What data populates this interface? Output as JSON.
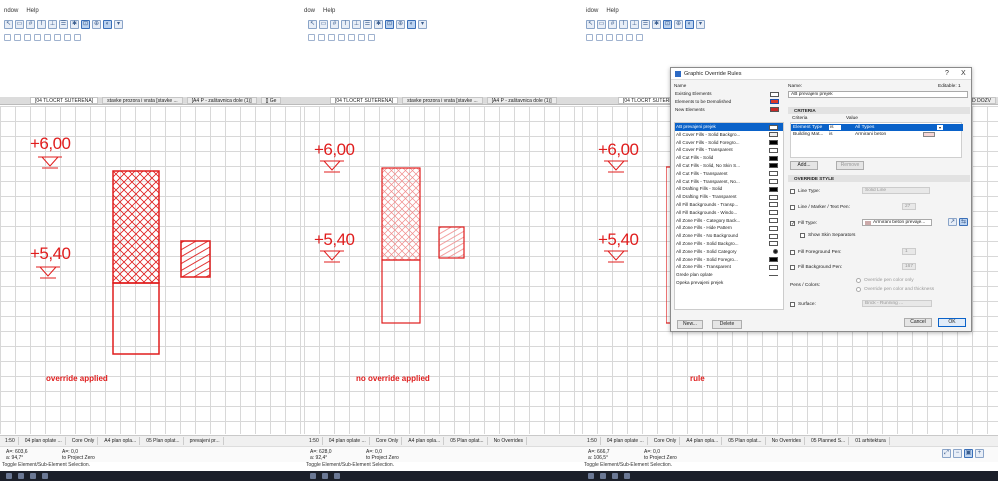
{
  "menu": {
    "window": "ndow",
    "help": "Help",
    "window2": "dow",
    "window3": "idow"
  },
  "tabs": {
    "p1": [
      "[04 TLOCRT SUTERENA]",
      "stavke prozora i vrata [stavke ...",
      "[A4 P - zaštavnica dole (1)]",
      "[] Ge"
    ],
    "p2": [
      "[04 TLOCRT SUTERENA]",
      "stavke prozora i vrata [stavke ...",
      "[A4 P - zaštavnica dole (1)]"
    ],
    "p3": [
      "[04 TLOCRT SUTERENA]",
      "GRAD DOZV"
    ]
  },
  "elevations": {
    "upper": "+6,00",
    "lower": "+5,40"
  },
  "captions": {
    "p1": "override applied",
    "p2": "no override applied",
    "p3": "rule"
  },
  "status": {
    "p1": [
      "1:50",
      "04 plan oplate ...",
      "Core Only",
      "A4 plan opla...",
      "05 Plan oplat...",
      "prevajeni pr..."
    ],
    "p2": [
      "1:50",
      "04 plan oplate ...",
      "Core Only",
      "A4 plan opla...",
      "05 Plan oplat...",
      "No Overrides"
    ],
    "p3": [
      "1:50",
      "04 plan oplate ...",
      "Core Only",
      "A4 plan opla...",
      "05 Plan oplat...",
      "No Overrides",
      "05 Planned S...",
      "01 arhitektura"
    ]
  },
  "coords": {
    "p1": {
      "a": "A=: 603,6",
      "b": "a: 94,7°",
      "c": "A=: 0,0",
      "d": "to Project Zero"
    },
    "p2": {
      "a": "A=: 628,0",
      "b": "a: 92,4°",
      "c": "A=: 0,0",
      "d": "to Project Zero"
    },
    "p3": {
      "a": "A=: 666,7",
      "b": "a: 106,5°",
      "c": "A=: 0,0",
      "d": "to Project Zero"
    }
  },
  "hint": "Toggle Element/Sub-Element Selection.",
  "dialog": {
    "title": "Graphic Override Rules",
    "help": "?",
    "close": "X",
    "left_header": "Name",
    "existing": [
      "Existing Elements",
      "Elements to be Demolished",
      "New Elements"
    ],
    "rules": [
      "AB prevajeni prejek",
      "All Cover Fills - Solid Backgro...",
      "All Cover Fills - Solid Foregro...",
      "All Cover Fills - Transparent",
      "All Cut Fills - Solid",
      "All Cut Fills - Solid, No Skin S...",
      "All Cut Fills - Transparent",
      "All Cut Fills - Transparent, No...",
      "All Drafting Fills - Solid",
      "All Drafting Fills - Transparent",
      "All Fill Backgrounds - Transp...",
      "All Fill Backgrounds - Windo...",
      "All Zone Fills - Category Back...",
      "All Zone Fills - Hide Pattern",
      "All Zone Fills - No Background",
      "All Zone Fills - Solid Backgro...",
      "All Zone Fills - Solid Category",
      "All Zone Fills - Solid Foregro...",
      "All Zone Fills - Transparent",
      "Grede plan oplate",
      "Opeka prevajeni prejek"
    ],
    "new_btn": "New...",
    "delete_btn": "Delete",
    "name_label": "Name:",
    "editable": "Editable: 1",
    "name_value": "AB prevajeni prejek",
    "criteria_head": "CRITERIA",
    "crit_col1": "Criteria",
    "crit_col2": "Value",
    "crit_rows": [
      {
        "c": "Element Type",
        "op": "is",
        "v": "All Types"
      },
      {
        "c": "Building Mat...",
        "op": "is",
        "v": "Armirani beton"
      }
    ],
    "add_btn": "Add...",
    "remove_btn": "Remove",
    "style_head": "OVERRIDE STYLE",
    "line_type": "Line Type:",
    "line_type_val": "Solid Line",
    "line_pen": "Line / Marker / Text Pen:",
    "line_pen_num": "27",
    "fill_type": "Fill Type:",
    "fill_type_val": "Armirani beton prevaje...",
    "skin_sep": "Show Skin Separators",
    "fg_pen": "Fill Foreground Pen:",
    "fg_pen_num": "1",
    "bg_pen": "Fill Background Pen:",
    "bg_pen_num": "167",
    "pens_colors": "Pens / Colors:",
    "pen_only": "Override pen color only",
    "pen_thick": "Override pen color and thickness",
    "surface": "Surface:",
    "surface_val": "Brick - Running ...",
    "cancel_btn": "Cancel",
    "ok_btn": "OK"
  },
  "colors": {
    "red": "#e01d1d",
    "select": "#0a62c9",
    "grid": "#d8d8d8"
  }
}
